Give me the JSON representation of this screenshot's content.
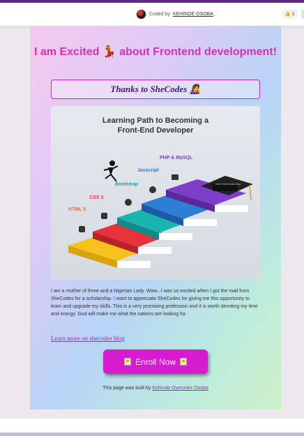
{
  "topbar": {
    "author_prefix": "Coded by",
    "author_name": "KEHINDE OSOBA",
    "like_icon": "thumbs-up-icon",
    "like_count": "1"
  },
  "card": {
    "headline": "I am Excited 💃 about Frontend development!",
    "thanks": "Thanks to SheCodes 👩‍🎤",
    "hero": {
      "title_line1": "Learning Path to Becoming a",
      "title_line2": "Front-End Developer",
      "steps": [
        "HTML 5",
        "CSS 3",
        "Bootstrap",
        "Javscript",
        "PHP & MySQL"
      ],
      "cap_text": "FRONT END DEVELOPER"
    },
    "bio": "I am a mother of three and a Nigerian Lady. Wow...I was so excited when I got the mail from SheCodes for a scholarship. I want to appreciate SheCodes for giving me this opportunity to learn and upgrade my skills. This is a very promising profession and it is worth devoting my time and energy. God will make me what the nations are looking for.",
    "blog_link": "Learn more on shecodes blog",
    "enroll_label": "Enroll Now",
    "footer_prefix": "This page was built by",
    "footer_author": "Kehinde Oyeronke Osoba"
  },
  "colors": {
    "accent": "#d630b6",
    "button": "#d61bd0",
    "topline": "#5b2a86"
  }
}
